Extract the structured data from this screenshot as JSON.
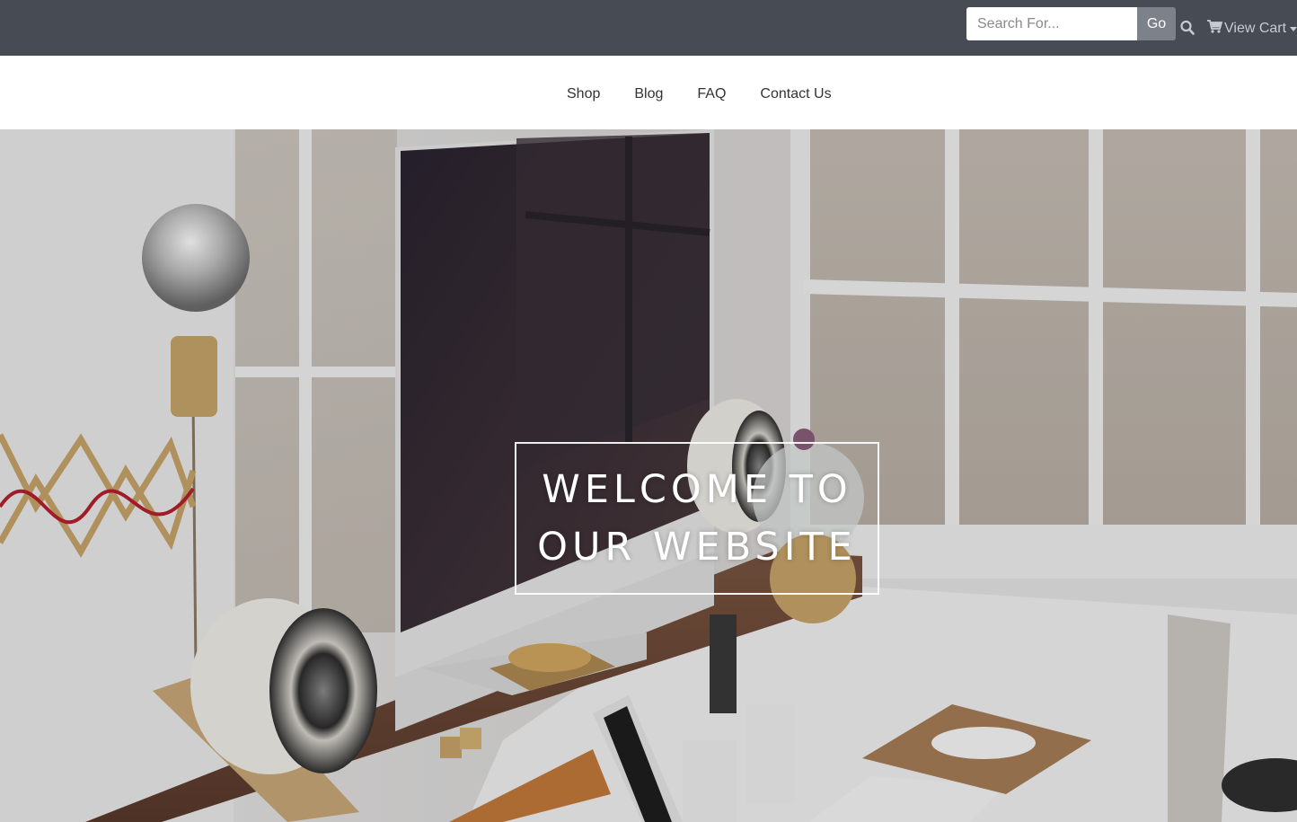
{
  "header": {
    "search": {
      "placeholder": "Search For...",
      "value": ""
    },
    "go_label": "Go",
    "search_icon": "search-icon",
    "cart": {
      "icon": "cart-icon",
      "label": "View Cart"
    }
  },
  "nav": {
    "items": [
      {
        "label": "Shop"
      },
      {
        "label": "Blog"
      },
      {
        "label": "FAQ"
      },
      {
        "label": "Contact Us"
      }
    ]
  },
  "hero": {
    "line1": "WELCOME TO",
    "line2": "OUR WEBSITE",
    "background": "workspace-photo"
  },
  "colors": {
    "topbar": "#464b54",
    "go_button": "#7c818a",
    "nav_bg": "#ffffff",
    "nav_text": "#333333"
  }
}
